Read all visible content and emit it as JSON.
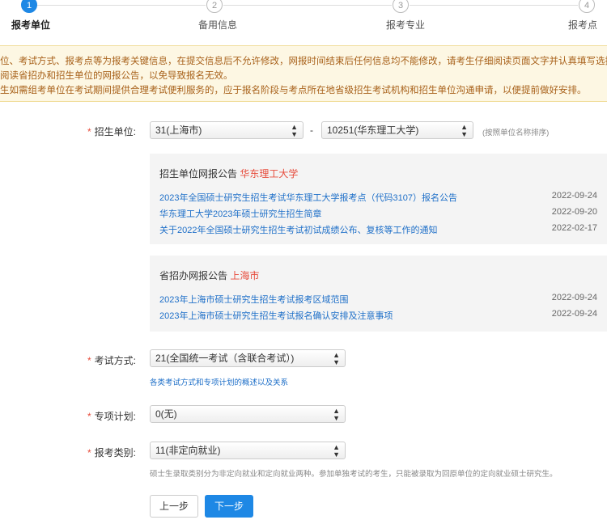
{
  "steps": [
    {
      "num": "1",
      "label": "报考单位"
    },
    {
      "num": "2",
      "label": "备用信息"
    },
    {
      "num": "3",
      "label": "报考专业"
    },
    {
      "num": "4",
      "label": "报考点"
    }
  ],
  "notice": {
    "lines": [
      "位、考试方式、报考点等为报考关键信息，在提交信息后不允许修改，网报时间结束后任何信息均不能修改，请考生仔细阅读页面文字并认真填写选择。",
      "阅读省招办和招生单位的网报公告，以免导致报名无效。",
      "生如需组考单位在考试期间提供合理考试便利服务的，应于报名阶段与考点所在地省级招生考试机构和招生单位沟通申请，以便提前做好安排。"
    ]
  },
  "form": {
    "unit_label": "招生单位:",
    "province_value": "31(上海市)",
    "dash": "-",
    "school_value": "10251(华东理工大学)",
    "unit_hint": "(按照单位名称排序)",
    "exam_label": "考试方式:",
    "exam_value": "21(全国统一考试（含联合考试）)",
    "exam_link": "各类考试方式和专项计划的概述以及关系",
    "plan_label": "专项计划:",
    "plan_value": "0(无)",
    "category_label": "报考类别:",
    "category_value": "11(非定向就业)",
    "category_hint": "硕士生录取类别分为非定向就业和定向就业两种。参加单独考试的考生，只能被录取为回原单位的定向就业硕士研究生。"
  },
  "school_panel": {
    "title": "招生单位网报公告",
    "highlight": "华东理工大学",
    "items": [
      {
        "title": "2023年全国硕士研究生招生考试华东理工大学报考点（代码3107）报名公告",
        "date": "2022-09-24"
      },
      {
        "title": "华东理工大学2023年硕士研究生招生简章",
        "date": "2022-09-20"
      },
      {
        "title": "关于2022年全国硕士研究生招生考试初试成绩公布、复核等工作的通知",
        "date": "2022-02-17"
      }
    ]
  },
  "province_panel": {
    "title": "省招办网报公告",
    "highlight": "上海市",
    "items": [
      {
        "title": "2023年上海市硕士研究生招生考试报考区域范围",
        "date": "2022-09-24"
      },
      {
        "title": "2023年上海市硕士研究生招生考试报名确认安排及注意事项",
        "date": "2022-09-24"
      }
    ]
  },
  "buttons": {
    "prev": "上一步",
    "next": "下一步"
  },
  "colors": {
    "accent": "#1e88e5",
    "link": "#1e6fc8",
    "required": "#e74c3c",
    "notice_text": "#a8611a"
  }
}
